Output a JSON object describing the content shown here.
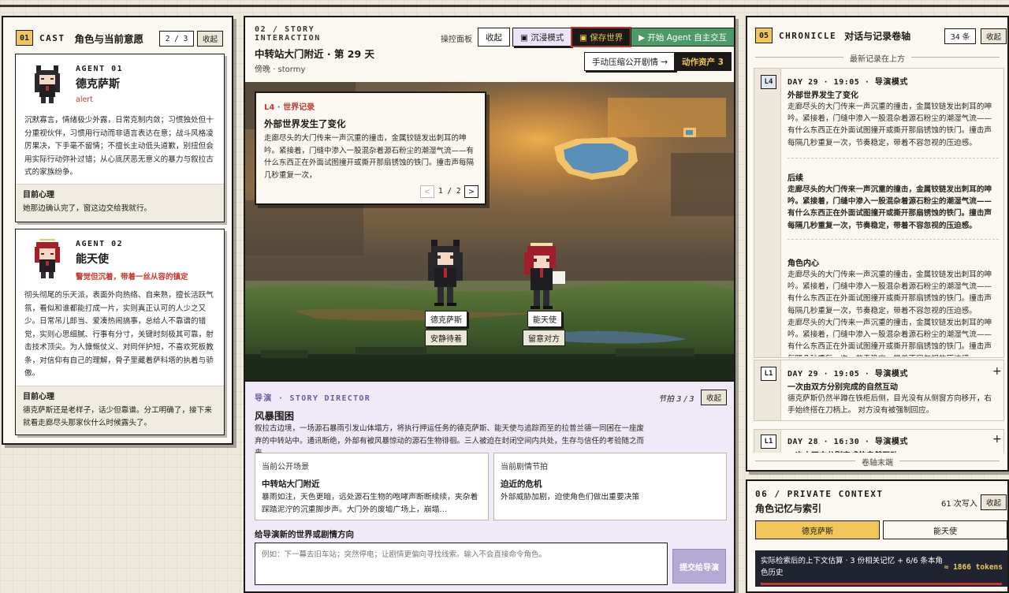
{
  "cast": {
    "badge": "01",
    "label": "CAST",
    "title": "角色与当前意愿",
    "pager": "2 / 3",
    "collapse_label": "收起",
    "agents": [
      {
        "tag": "AGENT 01",
        "name": "德克萨斯",
        "status": "alert",
        "bio": "沉默寡言，情绪极少外露，日常克制内敛；习惯独处但十分重视伙伴，习惯用行动而非语言表达在意；战斗风格凌厉果决，下手毫不留情；不擅长主动低头道歉，别扭但会用实际行动弥补过错；从心底厌恶无意义的暴力与叙拉古式的家族纷争。",
        "mind_title": "目前心理",
        "mind_text": "她那边确认完了，窗这边交给我就行。"
      },
      {
        "tag": "AGENT 02",
        "name": "能天使",
        "status": "警觉但沉着，带着一丝从容的镇定",
        "bio": "彻头彻尾的乐天派，表面外向热络、自来熟，擅长活跃气氛，看似和谁都能打成一片，实则真正认可的人少之又少。日常吊儿郎当、爱凑热闹搞事，总给人不靠谱的错觉，实则心思细腻、行事有分寸，关键时刻极其可靠，射击技术顶尖。为人慷慨仗义、对同伴护短，不喜欢死板教条，对信仰有自己的理解，骨子里藏着萨科塔的执着与骄傲。",
        "mind_title": "目前心理",
        "mind_text": "德克萨斯还是老样子，话少但靠谱。分工明确了，接下来就看走廊尽头那家伙什么时候露头了。"
      }
    ]
  },
  "story": {
    "label": "02 / STORY INTERACTION",
    "location": "中转站大门附近 · 第 29 天",
    "time_weather": "傍晚 · stormy",
    "control_label": "操控面板",
    "collapse_label": "收起",
    "immersive_label": "▣ 沉浸模式",
    "save_label": "▣ 保存世界",
    "start_agent_label": "▶ 开始 Agent 自主交互",
    "compress_label": "手动压缩公开剧情 →",
    "assets_label": "动作资产 3",
    "world_card": {
      "level": "L4 · 世界记录",
      "title": "外部世界发生了变化",
      "body": "走廊尽头的大门传来一声沉重的撞击，金属铰链发出刺耳的呻吟。紧接着，门缝中渗入一股混杂着源石粉尘的潮湿气流——有什么东西正在外面试图撞开或撕开那扇锈蚀的铁门。撞击声每隔几秒重复一次，",
      "pager": "1 / 2",
      "prev": "<",
      "next": ">"
    },
    "characters": [
      {
        "name": "德克萨斯",
        "state": "安静待着"
      },
      {
        "name": "能天使",
        "state": "留意对方"
      }
    ],
    "director": {
      "label": "导演 · STORY DIRECTOR",
      "beat": "节拍 3 / 3",
      "collapse_label": "收起",
      "title": "风暴围困",
      "desc": "叙拉古边境，一场源石暴雨引发山体塌方，将执行押运任务的德克萨斯、能天使与追踪而至的拉普兰德一同困在一座废弃的中转站中。通讯断绝，外部有被风暴惊动的源石生物徘徊。三人被迫在封闭空间内共处，生存与信任的考验随之而来。",
      "scene_box": {
        "heading": "当前公开场景",
        "title": "中转站大门附近",
        "text": "暴雨如注，天色更暗，远处源石生物的咆哮声断断续续，夹杂着踩踏泥泞的沉重脚步声。大门外的废墟广场上，崩塌…"
      },
      "beat_box": {
        "heading": "当前剧情节拍",
        "title": "迫近的危机",
        "text": "外部威胁加剧，迫使角色们做出重要决策"
      },
      "input_label": "给导演新的世界或剧情方向",
      "input_placeholder": "例如：下一幕去旧车站；突然停电；让剧情更偏向寻找线索。输入不会直接命令角色。",
      "submit_label": "提交给导演"
    }
  },
  "chronicle": {
    "badge": "05",
    "label": "CHRONICLE",
    "title": "对话与记录卷轴",
    "count": "34 条",
    "collapse_label": "收起",
    "top_marker": "最新记录在上方",
    "bottom_marker": "卷轴末端",
    "entries": [
      {
        "tag": "L4",
        "header": "DAY 29 · 19:05 · 导演模式",
        "title": "外部世界发生了变化",
        "body": "走廊尽头的大门传来一声沉重的撞击，金属铰链发出刺耳的呻吟。紧接着，门缝中渗入一股混杂着源石粉尘的潮湿气流——有什么东西正在外面试图撞开或撕开那扇锈蚀的铁门。撞击声每隔几秒重复一次，节奏稳定，带着不容忽视的压迫感。",
        "sec2_title": "后续",
        "sec2_body": "走廊尽头的大门传来一声沉重的撞击，金属铰链发出刺耳的呻吟。紧接着，门缝中渗入一股混杂着源石粉尘的潮湿气流——有什么东西正在外面试图撞开或撕开那扇锈蚀的铁门。撞击声每隔几秒重复一次，节奏稳定，带着不容忽视的压迫感。",
        "sec3_title": "角色内心",
        "sec3_body": "走廊尽头的大门传来一声沉重的撞击，金属铰链发出刺耳的呻吟。紧接着，门缝中渗入一股混杂着源石粉尘的潮湿气流——有什么东西正在外面试图撞开或撕开那扇锈蚀的铁门。撞击声每隔几秒重复一次，节奏稳定，带着不容忽视的压迫感。",
        "sec3_body2": "走廊尽头的大门传来一声沉重的撞击，金属铰链发出刺耳的呻吟。紧接着，门缝中渗入一股混杂着源石粉尘的潮湿气流——有什么东西正在外面试图撞开或撕开那扇锈蚀的铁门。撞击声每隔几秒重复一次，节奏稳定，带着不容忽视的压迫感。"
      },
      {
        "tag": "L1",
        "header": "DAY 29 · 19:05 · 导演模式",
        "title": "一次由双方分别完成的自然互动",
        "body": "德克萨斯仍然半蹲在铁柜后侧，目光没有从侧窗方向移开，右手始终搭在刀柄上。 对方没有被强制回应。",
        "expand": "+"
      },
      {
        "tag": "L1",
        "header": "DAY 28 · 16:30 · 导演模式",
        "title": "一次由双方分别完成的自然互动",
        "expand": "+"
      }
    ]
  },
  "private": {
    "label": "06 / PRIVATE CONTEXT",
    "title": "角色记忆与索引",
    "writes": "61 次写入",
    "collapse_label": "收起",
    "tabs": [
      "德克萨斯",
      "能天使"
    ],
    "estimate_text": "实际检索后的上下文估算 · 3 份相关记忆 + 6/6 条本角色历史",
    "tokens": "≈ 1866 tokens"
  },
  "colors": {
    "accent_yellow": "#f1c857",
    "alert_red": "#c8372f",
    "director_purple": "#6b5ca3",
    "start_green": "#4d9a66",
    "ink": "#1c1a17"
  }
}
